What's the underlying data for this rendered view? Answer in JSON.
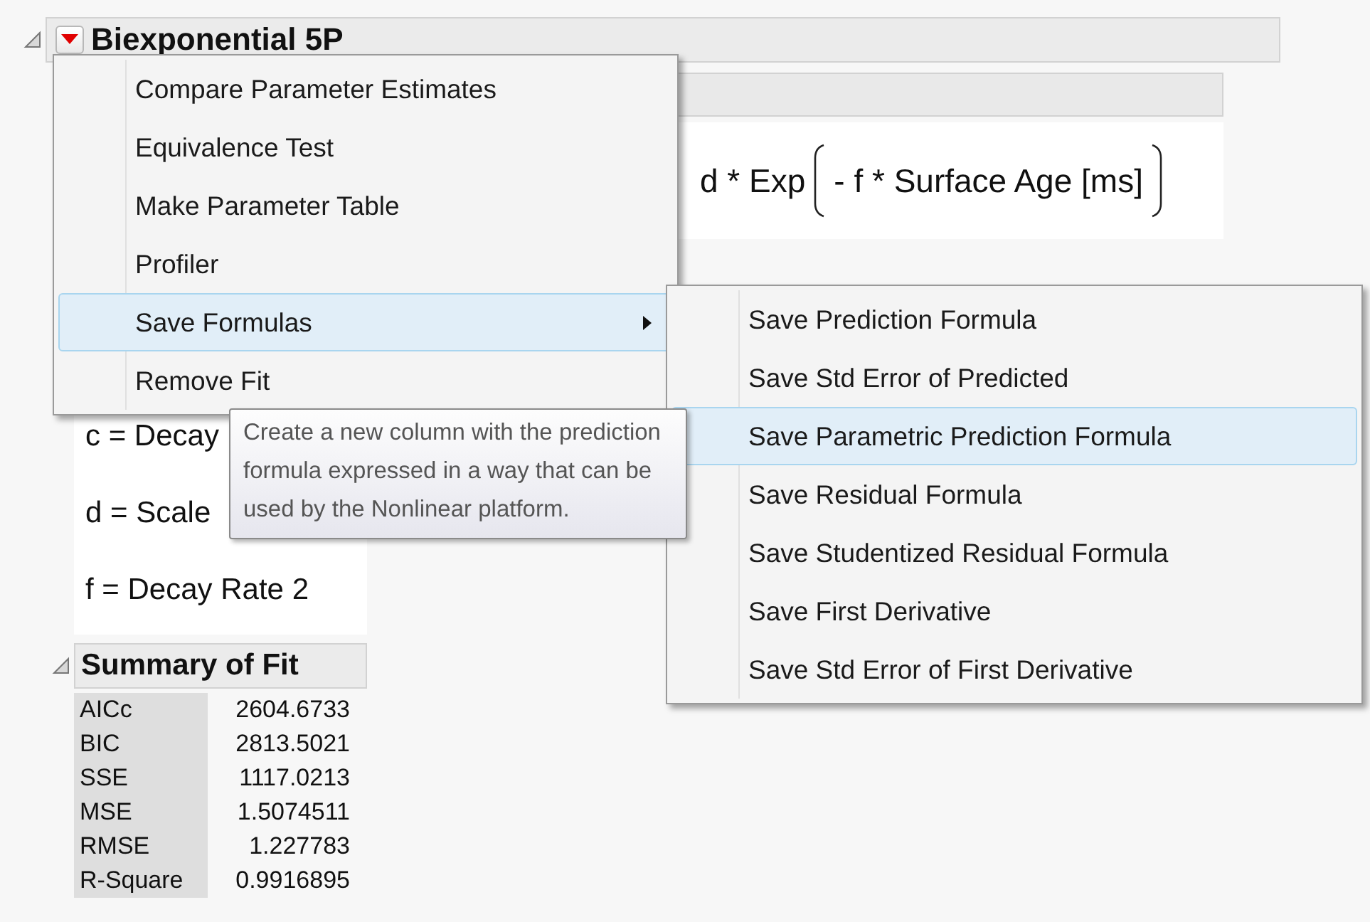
{
  "report": {
    "title": "Biexponential 5P",
    "expanded": true
  },
  "formula": {
    "function_part": "d * Exp",
    "argument": "- f * Surface Age [ms]"
  },
  "parameters": [
    "c = Decay",
    "d = Scale",
    "f = Decay Rate 2"
  ],
  "summary_of_fit": {
    "title": "Summary of Fit",
    "expanded": true,
    "rows": [
      {
        "label": "AICc",
        "value": "2604.6733"
      },
      {
        "label": "BIC",
        "value": "2813.5021"
      },
      {
        "label": "SSE",
        "value": "1117.0213"
      },
      {
        "label": "MSE",
        "value": "1.5074511"
      },
      {
        "label": "RMSE",
        "value": "1.227783"
      },
      {
        "label": "R-Square",
        "value": "0.9916895"
      }
    ]
  },
  "menu": {
    "items": [
      {
        "label": "Compare Parameter Estimates",
        "selected": false,
        "submenu": false
      },
      {
        "label": "Equivalence Test",
        "selected": false,
        "submenu": false
      },
      {
        "label": "Make Parameter Table",
        "selected": false,
        "submenu": false
      },
      {
        "label": "Profiler",
        "selected": false,
        "submenu": false
      },
      {
        "label": "Save Formulas",
        "selected": true,
        "submenu": true
      },
      {
        "label": "Remove Fit",
        "selected": false,
        "submenu": false
      }
    ]
  },
  "submenu": {
    "items": [
      {
        "label": "Save Prediction Formula",
        "selected": false
      },
      {
        "label": "Save Std Error of Predicted",
        "selected": false
      },
      {
        "label": "Save Parametric Prediction Formula",
        "selected": true
      },
      {
        "label": "Save Residual Formula",
        "selected": false
      },
      {
        "label": "Save Studentized Residual Formula",
        "selected": false
      },
      {
        "label": "Save First Derivative",
        "selected": false
      },
      {
        "label": "Save Std Error of First Derivative",
        "selected": false
      }
    ]
  },
  "tooltip": {
    "text": "Create a new column with the prediction formula expressed in a way that can be used by the Nonlinear platform."
  }
}
